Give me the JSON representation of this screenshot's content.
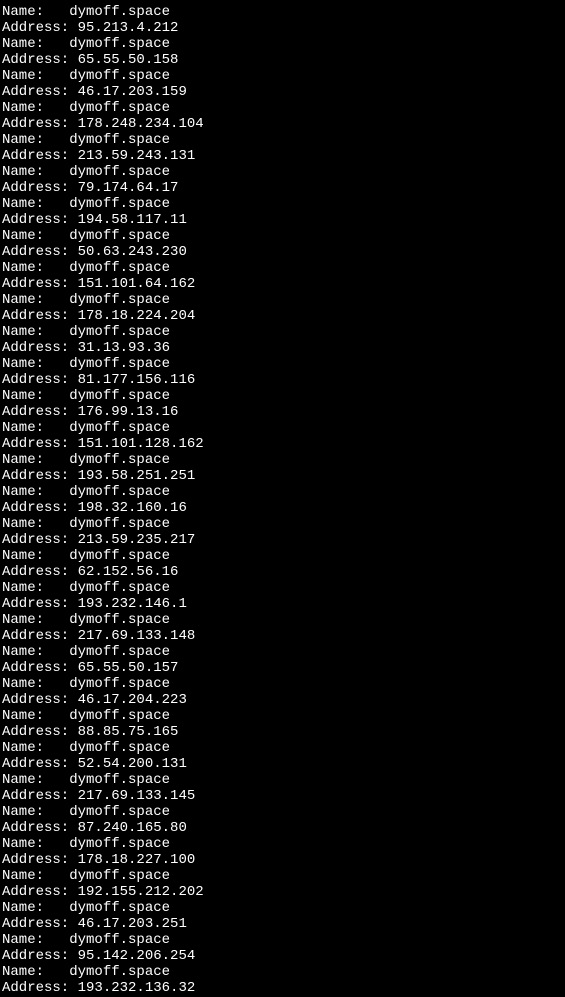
{
  "labels": {
    "name_label": "Name:   ",
    "address_label": "Address: "
  },
  "entries": [
    {
      "name": "dymoff.space",
      "address": "95.213.4.212"
    },
    {
      "name": "dymoff.space",
      "address": "65.55.50.158"
    },
    {
      "name": "dymoff.space",
      "address": "46.17.203.159"
    },
    {
      "name": "dymoff.space",
      "address": "178.248.234.104"
    },
    {
      "name": "dymoff.space",
      "address": "213.59.243.131"
    },
    {
      "name": "dymoff.space",
      "address": "79.174.64.17"
    },
    {
      "name": "dymoff.space",
      "address": "194.58.117.11"
    },
    {
      "name": "dymoff.space",
      "address": "50.63.243.230"
    },
    {
      "name": "dymoff.space",
      "address": "151.101.64.162"
    },
    {
      "name": "dymoff.space",
      "address": "178.18.224.204"
    },
    {
      "name": "dymoff.space",
      "address": "31.13.93.36"
    },
    {
      "name": "dymoff.space",
      "address": "81.177.156.116"
    },
    {
      "name": "dymoff.space",
      "address": "176.99.13.16"
    },
    {
      "name": "dymoff.space",
      "address": "151.101.128.162"
    },
    {
      "name": "dymoff.space",
      "address": "193.58.251.251"
    },
    {
      "name": "dymoff.space",
      "address": "198.32.160.16"
    },
    {
      "name": "dymoff.space",
      "address": "213.59.235.217"
    },
    {
      "name": "dymoff.space",
      "address": "62.152.56.16"
    },
    {
      "name": "dymoff.space",
      "address": "193.232.146.1"
    },
    {
      "name": "dymoff.space",
      "address": "217.69.133.148"
    },
    {
      "name": "dymoff.space",
      "address": "65.55.50.157"
    },
    {
      "name": "dymoff.space",
      "address": "46.17.204.223"
    },
    {
      "name": "dymoff.space",
      "address": "88.85.75.165"
    },
    {
      "name": "dymoff.space",
      "address": "52.54.200.131"
    },
    {
      "name": "dymoff.space",
      "address": "217.69.133.145"
    },
    {
      "name": "dymoff.space",
      "address": "87.240.165.80"
    },
    {
      "name": "dymoff.space",
      "address": "178.18.227.100"
    },
    {
      "name": "dymoff.space",
      "address": "192.155.212.202"
    },
    {
      "name": "dymoff.space",
      "address": "46.17.203.251"
    },
    {
      "name": "dymoff.space",
      "address": "95.142.206.254"
    },
    {
      "name": "dymoff.space",
      "address": "193.232.136.32"
    }
  ]
}
